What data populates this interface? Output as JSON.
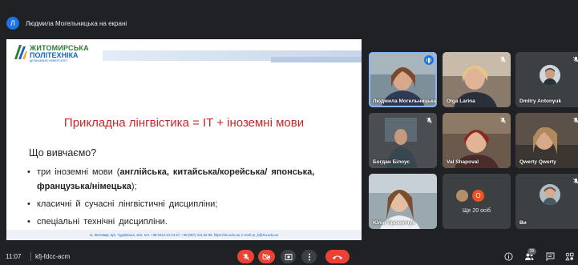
{
  "banner": {
    "initial": "Л",
    "text": "Людмила Могельницька на екрані"
  },
  "slide": {
    "logo": {
      "line1": "ЖИТОМИРСЬКА",
      "line2": "ПОЛІТЕХНІКА",
      "line3": "ДЕРЖАВНИЙ УНІВЕРСИТЕТ"
    },
    "title": "Прикладна лінгвістика = IT + іноземні мови",
    "subhead": "Що вивчаємо?",
    "bullet1_plain": "три іноземні мови (",
    "bullet1_bold": "англійська, китайська/корейська/ японська, французька/німецька",
    "bullet1_end": ");",
    "bullet2": "класичні й сучасні лінгвістичні дисципліни;",
    "bullet3": "спеціальні технічні дисципліни.",
    "footer": "м. Житомир, вул. Чуднівська, 103, тел. +38-0412-24-14-27; +38 (067) 411-32-95; https://ztu.edu.ua, e-mail: pr_k@ztu.edu.ua"
  },
  "participants": [
    {
      "name": "Людмила Могельницька",
      "speaking": true
    },
    {
      "name": "Olga Larina",
      "muted": true
    },
    {
      "name": "Dmitry Antonyuk",
      "muted": true
    },
    {
      "name": "Богдан Білоус",
      "muted": true
    },
    {
      "name": "Val Shapoval",
      "muted": true
    },
    {
      "name": "Qwerty Qwerty",
      "muted": true
    },
    {
      "name": "Юлія Прокопчук",
      "muted": true
    },
    {
      "name": "Ще 20 осіб",
      "badge": "O"
    },
    {
      "name": "Ви",
      "muted": true
    }
  ],
  "bottom": {
    "time": "11:07",
    "meeting_code": "kfj-fdcc-acm",
    "people_count": "29"
  },
  "colors": {
    "background": "#202124",
    "tile": "#3c4043",
    "accent_blue": "#1a73e8",
    "danger_red": "#ea4335",
    "title_red": "#c62828"
  }
}
